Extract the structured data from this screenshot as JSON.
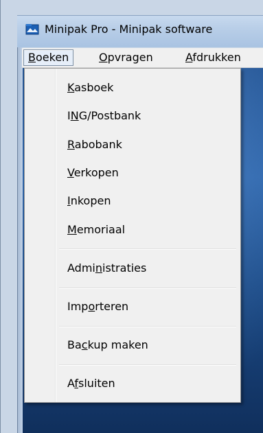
{
  "window": {
    "title": "Minipak Pro - Minipak software"
  },
  "menubar": {
    "items": [
      {
        "label": "Boeken",
        "mnemonic_index": 0,
        "active": true
      },
      {
        "label": "Opvragen",
        "mnemonic_index": 0,
        "active": false
      },
      {
        "label": "Afdrukken",
        "mnemonic_index": 0,
        "active": false
      }
    ]
  },
  "menu": {
    "groups": [
      [
        {
          "label": "Kasboek",
          "mnemonic_index": 0
        },
        {
          "label": "ING/Postbank",
          "mnemonic_index": 1
        },
        {
          "label": "Rabobank",
          "mnemonic_index": 0
        },
        {
          "label": "Verkopen",
          "mnemonic_index": 0
        },
        {
          "label": "Inkopen",
          "mnemonic_index": 0
        },
        {
          "label": "Memoriaal",
          "mnemonic_index": 0
        }
      ],
      [
        {
          "label": "Administraties",
          "mnemonic_index": 4
        }
      ],
      [
        {
          "label": "Importeren",
          "mnemonic_index": 3
        }
      ],
      [
        {
          "label": "Backup maken",
          "mnemonic_index": 2
        }
      ],
      [
        {
          "label": "Afsluiten",
          "mnemonic_index": 1
        }
      ]
    ]
  },
  "colors": {
    "menu_bg": "#f0f0f0",
    "desktop_dark_blue": "#1e4f8f",
    "titlebar_blue": "#b7cde7"
  }
}
